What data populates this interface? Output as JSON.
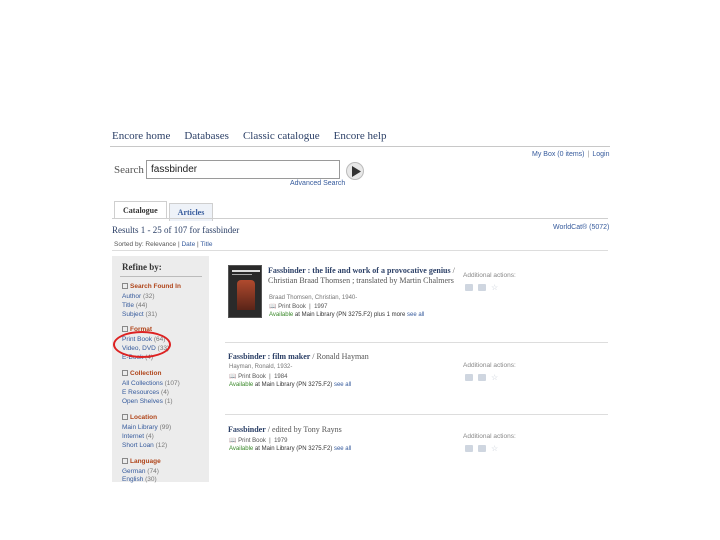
{
  "nav": {
    "items": [
      "Encore home",
      "Databases",
      "Classic catalogue",
      "Encore help"
    ]
  },
  "user": {
    "my_box": "My Box (0 items)",
    "login": "Login"
  },
  "search": {
    "label": "Search",
    "value": "fassbinder",
    "advanced": "Advanced Search"
  },
  "tabs": {
    "catalogue": "Catalogue",
    "articles": "Articles"
  },
  "results": {
    "heading": "Results 1 - 25 of 107 for fassbinder",
    "worldcat": "WorldCat® (5072)",
    "sorted_by": "Sorted by: Relevance |",
    "sort_date": "Date",
    "sort_sep": "|",
    "sort_title": "Title"
  },
  "refine": {
    "title": "Refine by:",
    "facets": [
      {
        "heading": "Search Found In",
        "items": [
          [
            "Author",
            "(32)"
          ],
          [
            "Title",
            "(44)"
          ],
          [
            "Subject",
            "(31)"
          ]
        ]
      },
      {
        "heading": "Format",
        "items": [
          [
            "Print Book",
            "(64)"
          ],
          [
            "Video, DVD",
            "(33)"
          ],
          [
            "E-Book",
            "(4)"
          ]
        ]
      },
      {
        "heading": "Collection",
        "items": [
          [
            "All Collections",
            "(107)"
          ],
          [
            "E Resources",
            "(4)"
          ],
          [
            "Open Shelves",
            "(1)"
          ]
        ]
      },
      {
        "heading": "Location",
        "items": [
          [
            "Main Library",
            "(99)"
          ],
          [
            "Internet",
            "(4)"
          ],
          [
            "Short Loan",
            "(12)"
          ]
        ]
      },
      {
        "heading": "Language",
        "items": [
          [
            "German",
            "(74)"
          ],
          [
            "English",
            "(30)"
          ]
        ]
      }
    ]
  },
  "records": [
    {
      "title": "Fassbinder : the life and work of a provocative genius",
      "responsibility": " / Christian Braad Thomsen ; translated by Martin Chalmers",
      "author": "Braad Thomsen, Christian, 1940-",
      "format": "Print Book",
      "year": "1997",
      "available": "Available",
      "location": "at Main Library (PN 3275.F2)",
      "more": "plus 1 more",
      "see_all": "see all"
    },
    {
      "title": "Fassbinder : film maker",
      "responsibility": " / Ronald Hayman",
      "author": "Hayman, Ronald, 1932-",
      "format": "Print Book",
      "year": "1984",
      "available": "Available",
      "location": "at Main Library (PN 3275.F2)",
      "more": "",
      "see_all": "see all"
    },
    {
      "title": "Fassbinder",
      "responsibility": " / edited by Tony Rayns",
      "author": "",
      "format": "Print Book",
      "year": "1979",
      "available": "Available",
      "location": "at Main Library (PN 3275.F2)",
      "more": "",
      "see_all": "see all"
    }
  ],
  "actions": {
    "label": "Additional actions:"
  },
  "colors": {
    "link": "#355a9c",
    "facet_heading": "#b0451a",
    "available": "#3a8a2a",
    "highlight_circle": "#dd2222"
  }
}
